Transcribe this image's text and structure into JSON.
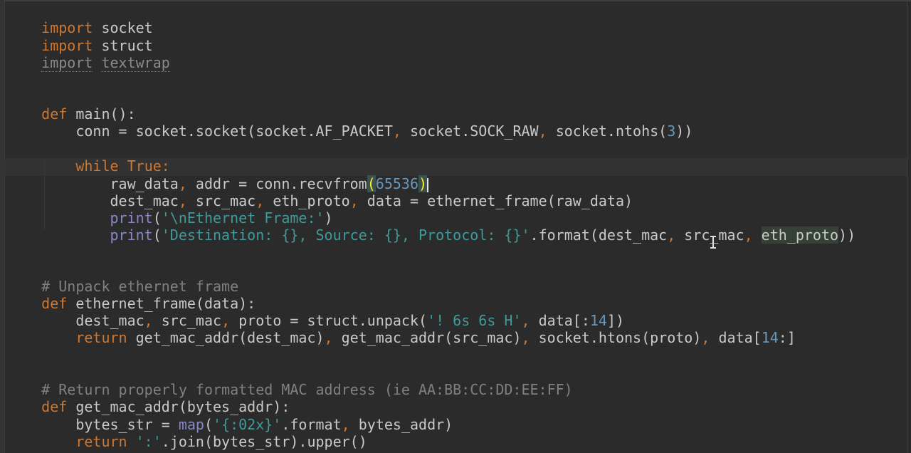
{
  "editor": {
    "colors": {
      "background": "#2b2b2b",
      "keyword": "#cc7832",
      "comment": "#808080",
      "number": "#6897bb",
      "string": "#3f9a9a",
      "text": "#c9c9c9"
    },
    "lines": {
      "l1": {
        "kw": "import",
        "rest": " socket"
      },
      "l2": {
        "kw": "import",
        "rest": " struct"
      },
      "l3": {
        "kw": "import",
        "rest": "textwrap"
      },
      "l5": {
        "kw": "def",
        "name": "main",
        "rest": "():"
      },
      "l6": {
        "a": "conn = socket.socket(socket.AF_PACKET",
        "b": ", ",
        "c": "socket.SOCK_RAW",
        "d": ", ",
        "e": "socket.ntohs(",
        "num": "3",
        "f": "))"
      },
      "l8": {
        "kw1": "while",
        "kw2": "True",
        "rest": ":"
      },
      "l9": {
        "a": "raw_data",
        "b": ", ",
        "c": "addr = conn.recvfrom",
        "open": "(",
        "num": "65536",
        "close": ")"
      },
      "l10": {
        "a": "dest_mac",
        "b": ", ",
        "c": "src_mac",
        "d": ", ",
        "e": "eth_proto",
        "f": ", ",
        "g": "data = ethernet_frame(raw_data)"
      },
      "l11": {
        "fn": "print",
        "open": "(",
        "str": "'\\nEthernet Frame:'",
        "close": ")"
      },
      "l12": {
        "fn": "print",
        "open": "(",
        "str": "'Destination: {}, Source: {}, Protocol: {}'",
        "a": ".format(dest_mac",
        "b": ", ",
        "c": "src_mac",
        "d": ", ",
        "e": "eth_proto",
        "f": "))"
      },
      "l14": {
        "cmt": "# Unpack ethernet frame"
      },
      "l15": {
        "kw": "def",
        "name": "ethernet_frame",
        "rest": "(data):"
      },
      "l16": {
        "a": "dest_mac",
        "b": ", ",
        "c": "src_mac",
        "d": ", ",
        "e": "proto = struct.unpack(",
        "str": "'! 6s 6s H'",
        "f": ", ",
        "g": "data[:",
        "num": "14",
        "h": "])"
      },
      "l17": {
        "kw": "return",
        "a": " get_mac_addr(dest_mac)",
        "b": ", ",
        "c": "get_mac_addr(src_mac)",
        "d": ", ",
        "e": "socket.htons(proto)",
        "f": ", ",
        "g": "data[",
        "num": "14",
        "h": ":]"
      },
      "l19": {
        "cmt": "# Return properly formatted MAC address (ie AA:BB:CC:DD:EE:FF)"
      },
      "l20": {
        "kw": "def",
        "name": "get_mac_addr",
        "rest": "(bytes_addr):"
      },
      "l21": {
        "a": "bytes_str = ",
        "bi": "map",
        "open": "(",
        "str": "'{:02x}'",
        "b": ".format",
        "c": ", ",
        "d": "bytes_addr)"
      },
      "l22": {
        "kw": "return",
        "sp": " ",
        "str": "':'",
        "a": ".join(bytes_str).upper()"
      }
    }
  }
}
